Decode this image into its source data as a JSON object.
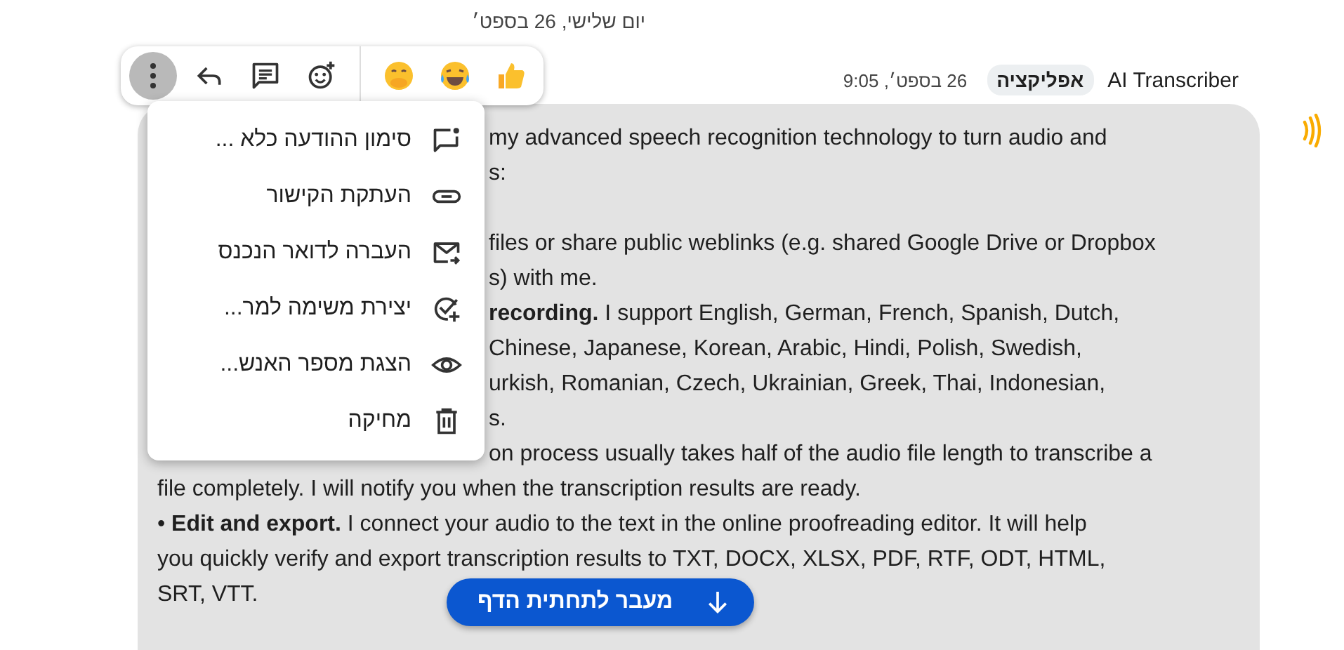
{
  "date_divider": "יום שלישי, 26 בספט׳",
  "toolbar": {
    "actions": [
      {
        "kind": "more",
        "selected": true
      },
      {
        "kind": "reply",
        "selected": false
      },
      {
        "kind": "thread",
        "selected": false
      },
      {
        "kind": "add-reaction",
        "selected": false
      }
    ],
    "reactions": [
      {
        "kind": "hand-over-mouth"
      },
      {
        "kind": "tears-of-joy"
      },
      {
        "kind": "thumbs-up"
      }
    ]
  },
  "message": {
    "sender": "AI Transcriber",
    "badge": "אפליקציה",
    "time": "26 בספט׳, 9:05",
    "covered_paragraphs": [
      [
        "my advanced speech recognition technology to turn audio and",
        "s:"
      ],
      [
        "files or share public weblinks (e.g. shared Google Drive or Dropbox",
        "s) with me.",
        "**recording.** I support English, German, French, Spanish, Dutch,",
        "Chinese, Japanese, Korean, Arabic, Hindi, Polish, Swedish,",
        "urkish, Romanian, Czech, Ukrainian, Greek, Thai, Indonesian,",
        "s.",
        "on process usually takes half of the audio file length to transcribe a"
      ]
    ],
    "lines": [
      "file completely. I will notify you when the transcription results are ready.",
      "• **Edit and export.** I connect your audio to the text in the online proofreading editor. It will help",
      "you quickly verify and export transcription results to TXT, DOCX, XLSX, PDF, RTF, ODT, HTML,",
      "SRT, VTT."
    ]
  },
  "menu": [
    {
      "kind": "mark-unread",
      "label": "סימון ההודעה כלא ..."
    },
    {
      "kind": "link",
      "label": "העתקת הקישור"
    },
    {
      "kind": "inbox",
      "label": "העברה לדואר הנכנס"
    },
    {
      "kind": "task",
      "label": "יצירת משימה למר..."
    },
    {
      "kind": "view",
      "label": "הצגת מספר האנש..."
    },
    {
      "kind": "delete",
      "label": "מחיקה"
    }
  ],
  "scroll_button": "מעבר לתחתית הדף"
}
